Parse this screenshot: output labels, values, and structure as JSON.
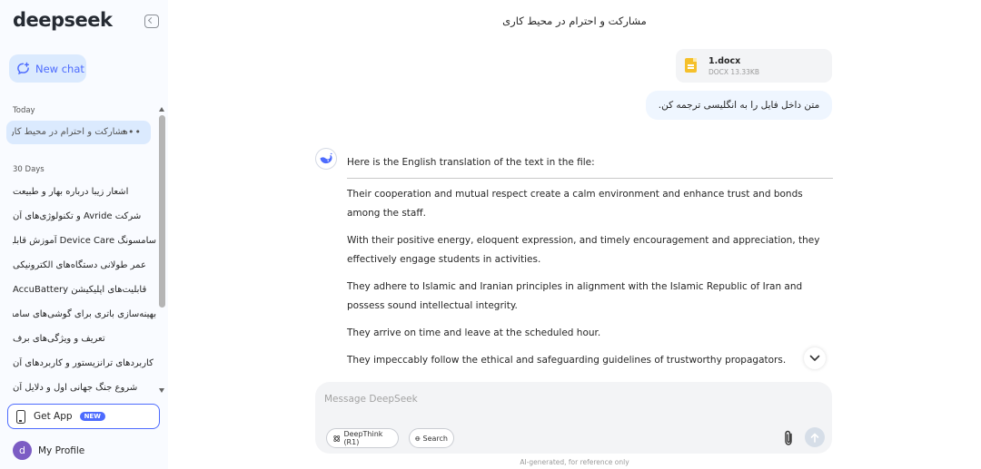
{
  "sidebar": {
    "logo": "deepseek",
    "new_chat_label": "New chat",
    "sections": {
      "today": "Today",
      "thirty_days": "30 Days"
    },
    "active_chat": "مشارکت و احترام در محیط کاری",
    "chats": [
      "اشعار زیبا درباره بهار و طبیعت",
      "شرکت Avride و تکنولوژی‌های آن",
      "سامسونگ Device Care آموزش قابلیت",
      "عمر طولانی دستگاه‌های الکترونیکی",
      "قابلیت‌های اپلیکیشن AccuBattery",
      "بهینه‌سازی باتری برای گوشی‌های سامسونگ",
      "تعریف و ویژگی‌های برف",
      "کاربردهای ترانزیستور و کاربردهای آن",
      "شروع جنگ جهانی اول و دلایل آن"
    ],
    "get_app_label": "Get App",
    "get_app_badge": "NEW",
    "profile_initial": "d",
    "profile_label": "My Profile"
  },
  "main": {
    "title": "مشارکت و احترام در محیط کاری",
    "file": {
      "name": "1.docx",
      "meta": "DOCX 13.33KB"
    },
    "user_message": "متن داخل فایل را به انگلیسی ترجمه کن.",
    "ai_intro": "Here is the English translation of the text in the file:",
    "ai_paragraphs": [
      "Their cooperation and mutual respect create a calm environment and enhance trust and bonds among the staff.",
      "With their positive energy, eloquent expression, and timely encouragement and appreciation, they effectively engage students in activities.",
      "They adhere to Islamic and Iranian principles in alignment with the Islamic Republic of Iran and possess sound intellectual integrity.",
      "They arrive on time and leave at the scheduled hour.",
      "They impeccably follow the ethical and safeguarding guidelines of trustworthy propagators."
    ],
    "input_placeholder": "Message DeepSeek",
    "deepthink_label": "DeepThink (R1)",
    "search_label": "Search",
    "footer_note": "AI-generated, for reference only"
  },
  "colors": {
    "accent": "#4d6bfe",
    "sidebar_bg": "#f9fbff",
    "active_bg": "#dbeafe"
  }
}
